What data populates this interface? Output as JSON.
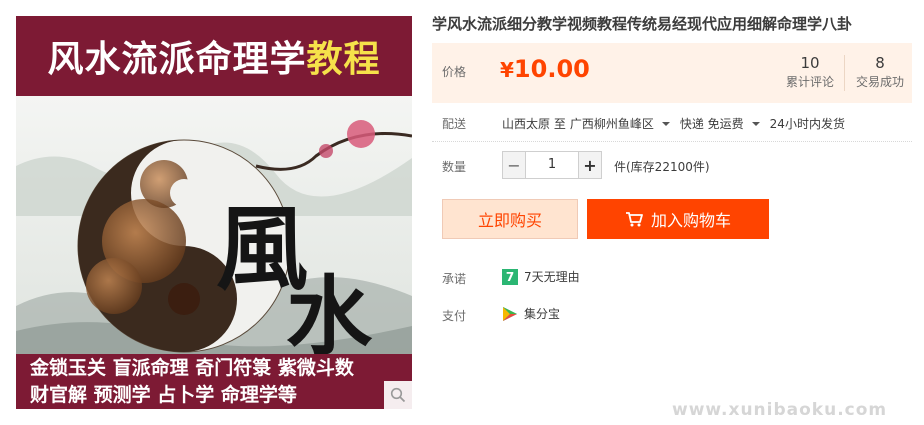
{
  "product_image": {
    "banner_top_white": "风水流派命理学",
    "banner_top_yellow": "教程",
    "calligraphy": "風水",
    "banner_bottom_line1": "金锁玉关 盲派命理 奇门符箓 紫微斗数",
    "banner_bottom_line2": "财官解 预测学 占卜学 命理学等",
    "zoom_icon": "search-icon"
  },
  "title": "学风水流派细分教学视频教程传统易经现代应用细解命理学八卦",
  "price": {
    "label": "价格",
    "currency": "¥",
    "amount": "10.00",
    "color": "#ff4400"
  },
  "stats": {
    "reviews_count": "10",
    "reviews_label": "累计评论",
    "deals_count": "8",
    "deals_label": "交易成功"
  },
  "delivery": {
    "label": "配送",
    "from": "山西太原 至",
    "to": "广西柳州鱼峰区",
    "method": "快递 免运费",
    "ship_time": "24小时内发货"
  },
  "quantity": {
    "label": "数量",
    "value": "1",
    "minus": "−",
    "plus": "+",
    "stock_text": "件(库存22100件)"
  },
  "buttons": {
    "buy_now": "立即购买",
    "add_to_cart": "加入购物车",
    "cart_icon": "cart-icon"
  },
  "promise": {
    "label": "承诺",
    "badge": "7",
    "text": "7天无理由"
  },
  "payment": {
    "label": "支付",
    "icon": "jifenbao-icon",
    "text": "集分宝"
  },
  "watermark": "www.xunibaoku.com",
  "colors": {
    "accent": "#ff4400",
    "banner": "#7d1a34",
    "banner_highlight": "#f6e24a",
    "price_bg": "#fff2e8",
    "badge_green": "#2bb673"
  }
}
